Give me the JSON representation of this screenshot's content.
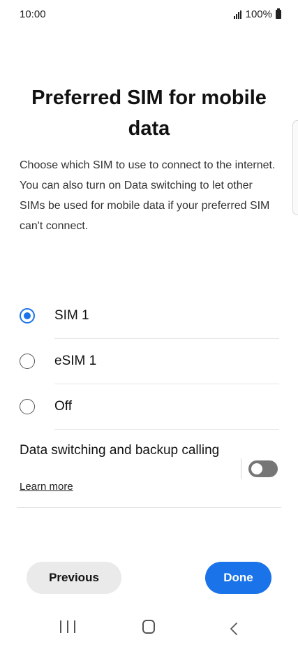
{
  "status_bar": {
    "time": "10:00",
    "battery": "100%",
    "icons": [
      "signal-icon",
      "battery-icon"
    ]
  },
  "page": {
    "title": "Preferred SIM for mobile data",
    "description": "Choose which SIM to use to connect to the internet. You can also turn on Data switching to let other SIMs be used for mobile data if your preferred SIM can't connect."
  },
  "options": [
    {
      "label": "SIM 1",
      "selected": true
    },
    {
      "label": "eSIM 1",
      "selected": false
    },
    {
      "label": "Off",
      "selected": false
    }
  ],
  "data_switching": {
    "title": "Data switching and backup calling",
    "learn_more": "Learn more",
    "enabled": false
  },
  "buttons": {
    "previous": "Previous",
    "done": "Done"
  },
  "nav_bar": {
    "icons": [
      "recents-icon",
      "home-icon",
      "back-icon"
    ]
  },
  "colors": {
    "accent": "#1a73e8",
    "toggle_off": "#767676",
    "secondary_button": "#eaeaea"
  }
}
